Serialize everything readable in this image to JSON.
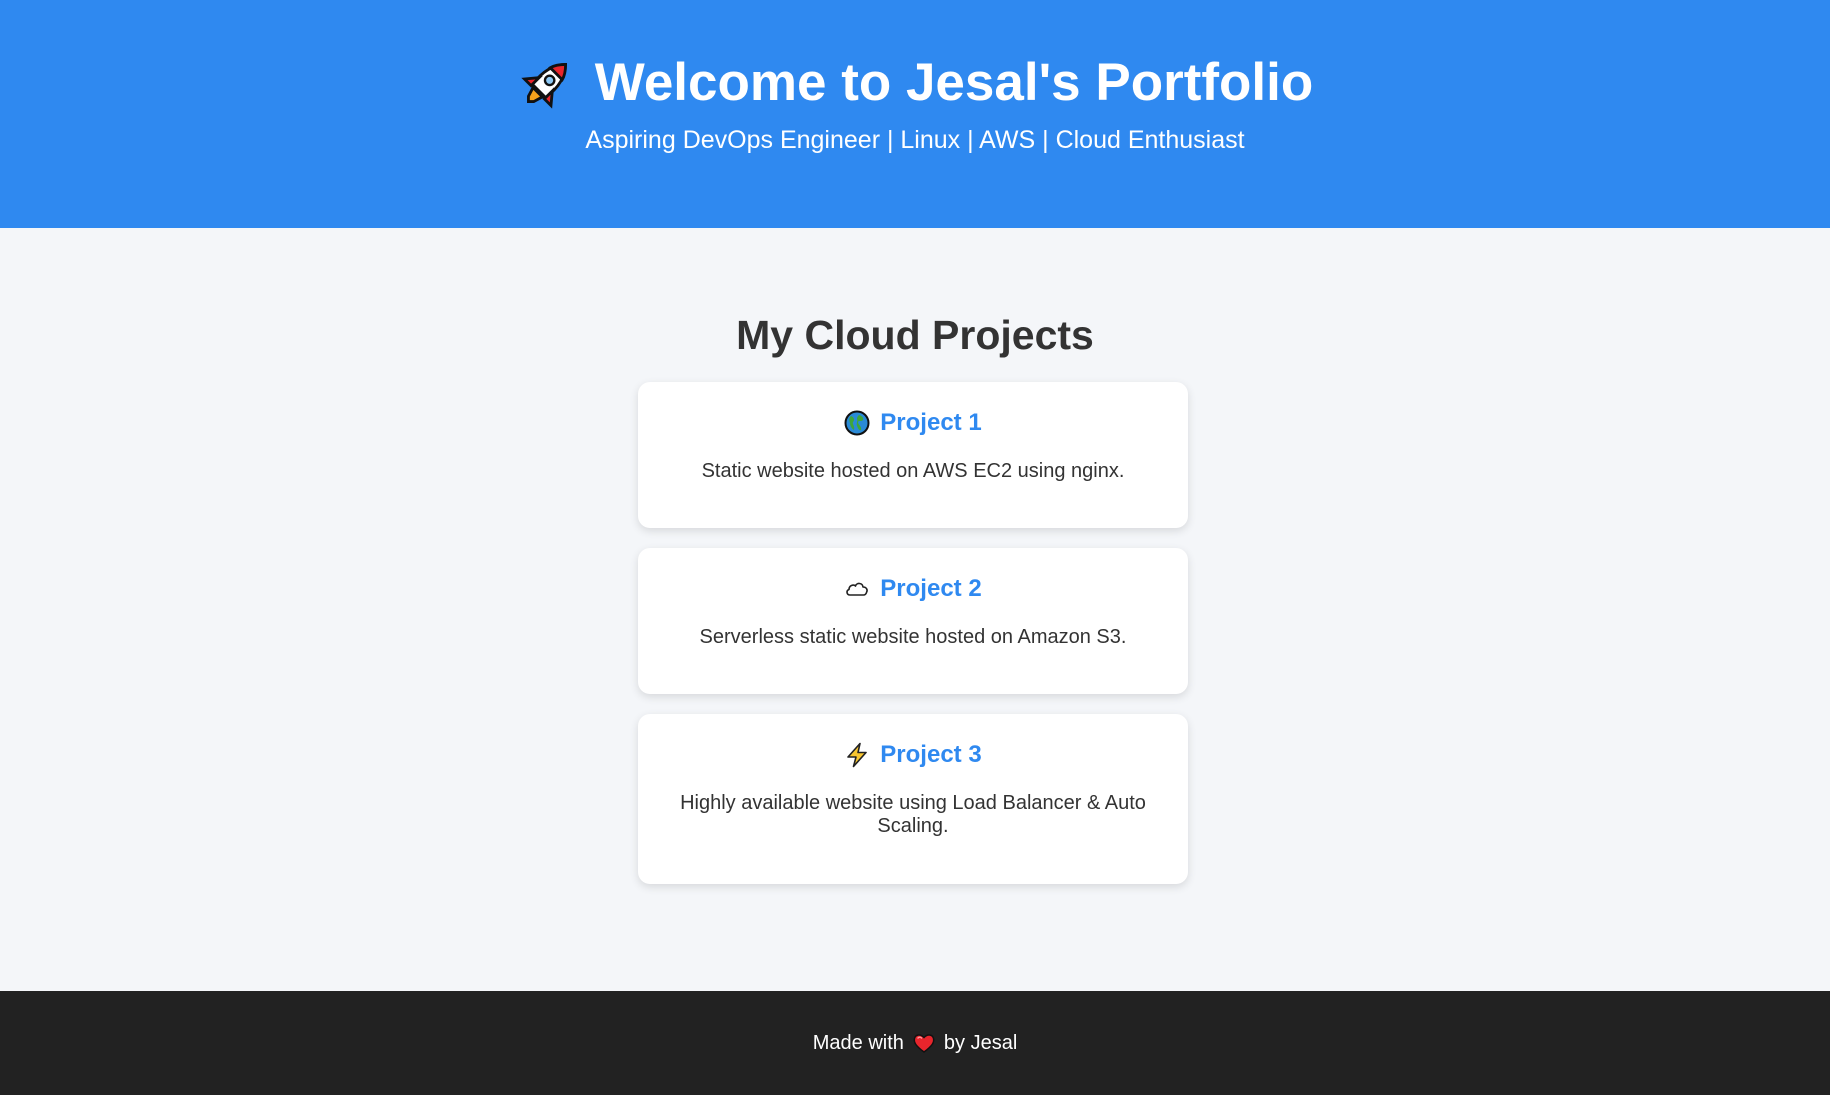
{
  "header": {
    "icon": "rocket-icon",
    "title": "Welcome to Jesal's Portfolio",
    "subtitle": "Aspiring DevOps Engineer | Linux | AWS | Cloud Enthusiast",
    "background_color": "#2f89f0"
  },
  "main": {
    "section_title": "My Cloud Projects",
    "projects": [
      {
        "icon": "globe-icon",
        "title": "Project 1",
        "description": "Static website hosted on AWS EC2 using nginx."
      },
      {
        "icon": "cloud-icon",
        "title": "Project 2",
        "description": "Serverless static website hosted on Amazon S3."
      },
      {
        "icon": "lightning-icon",
        "title": "Project 3",
        "description": "Highly available website using Load Balancer & Auto Scaling."
      }
    ]
  },
  "footer": {
    "text_before": "Made with",
    "icon": "heart-icon",
    "text_after": "by Jesal",
    "background_color": "#222222"
  },
  "colors": {
    "accent": "#2f89f0",
    "page_background": "#f4f6f9",
    "heading_text": "#333333"
  }
}
